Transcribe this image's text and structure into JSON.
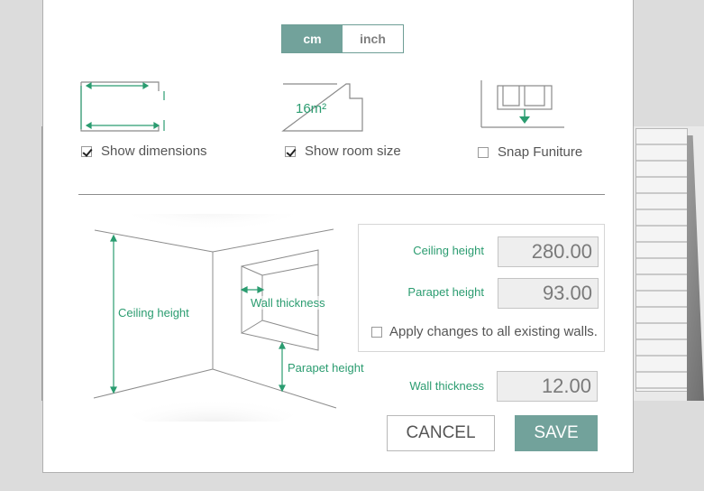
{
  "units": {
    "cm": "cm",
    "inch": "inch",
    "selected": "cm"
  },
  "options": [
    {
      "label": "Show dimensions",
      "checked": true,
      "icon": "dimensions-icon"
    },
    {
      "label": "Show room size",
      "checked": true,
      "icon": "room-size-icon",
      "icon_text": "16m²"
    },
    {
      "label": "Snap Funiture",
      "checked": false,
      "icon": "snap-furniture-icon"
    }
  ],
  "illustration": {
    "ceiling_label": "Ceiling height",
    "wall_thickness_label": "Wall thickness",
    "parapet_label": "Parapet height"
  },
  "fields": {
    "ceiling_height": {
      "label": "Ceiling height",
      "value": "280.00"
    },
    "parapet_height": {
      "label": "Parapet height",
      "value": "93.00"
    },
    "apply_all": {
      "label": "Apply changes to all existing walls.",
      "checked": false
    },
    "wall_thickness": {
      "label": "Wall thickness",
      "value": "12.00"
    }
  },
  "buttons": {
    "cancel": "CANCEL",
    "save": "SAVE"
  },
  "colors": {
    "accent": "#72a29b",
    "label_green": "#2b9c70"
  }
}
